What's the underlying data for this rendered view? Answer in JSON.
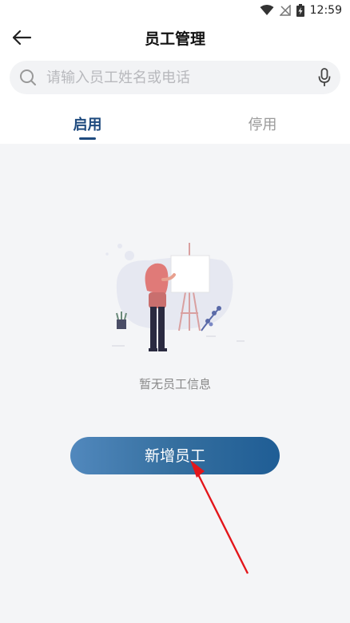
{
  "status_bar": {
    "time": "12:59",
    "icons": [
      "wifi-icon",
      "no-signal-icon",
      "battery-charging-icon"
    ]
  },
  "header": {
    "back_icon": "arrow-left-icon",
    "title": "员工管理"
  },
  "search": {
    "placeholder": "请输入员工姓名或电话",
    "value": "",
    "icon": "search-icon",
    "voice_icon": "microphone-icon"
  },
  "tabs": [
    {
      "label": "启用",
      "active": true
    },
    {
      "label": "停用",
      "active": false
    }
  ],
  "empty_state": {
    "message": "暂无员工信息",
    "illustration": "woman-painting-easel-illustration"
  },
  "actions": {
    "add_employee_label": "新增员工"
  },
  "colors": {
    "accent": "#1e4a7e",
    "button_start": "#5188bd",
    "button_end": "#1f5d95",
    "annotation_arrow": "#e3161b",
    "background": "#f4f5f7"
  }
}
